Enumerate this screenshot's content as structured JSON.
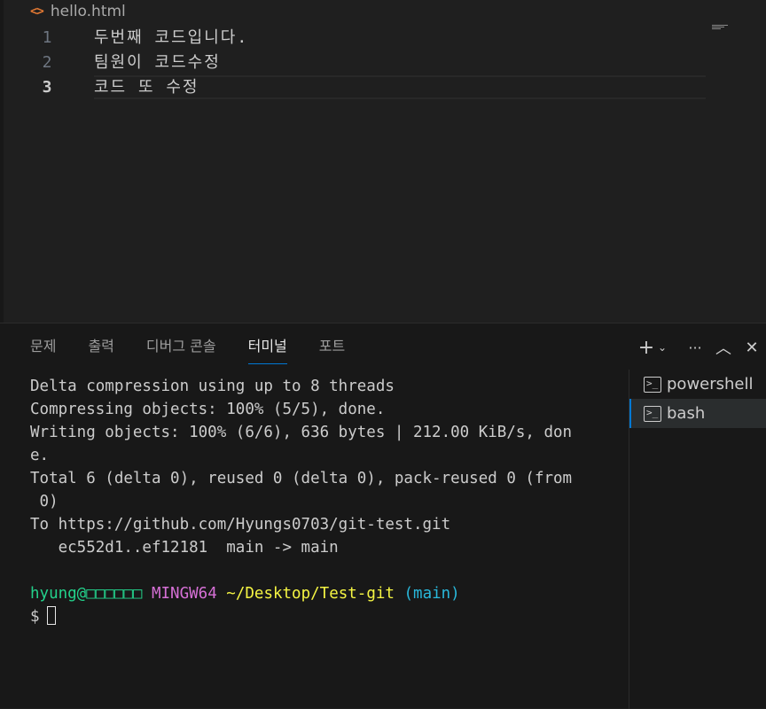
{
  "editor": {
    "file_name": "hello.html",
    "file_icon": "html-file-icon",
    "lines": [
      {
        "number": "1",
        "text": "두번째 코드입니다."
      },
      {
        "number": "2",
        "text": "팀원이 코드수정"
      },
      {
        "number": "3",
        "text": "코드 또 수정"
      }
    ]
  },
  "panel": {
    "tabs": [
      "문제",
      "출력",
      "디버그 콘솔",
      "터미널",
      "포트"
    ],
    "active_tab": "터미널",
    "actions": {
      "add": "+",
      "dropdown": "⌄",
      "more": "···",
      "maximize": "︿",
      "close": "✕"
    }
  },
  "terminal": {
    "lines": [
      "Delta compression using up to 8 threads",
      "Compressing objects: 100% (5/5), done.",
      "Writing objects: 100% (6/6), 636 bytes | 212.00 KiB/s, don",
      "e.",
      "Total 6 (delta 0), reused 0 (delta 0), pack-reused 0 (from",
      " 0)",
      "To https://github.com/Hyungs0703/git-test.git",
      "   ec552d1..ef12181  main -> main",
      ""
    ],
    "prompt": {
      "user_host": "hyung@□□□□□□",
      "system": "MINGW64",
      "path": "~/Desktop/Test-git",
      "branch": "(main)",
      "symbol": "$"
    },
    "instances": [
      {
        "name": "powershell",
        "selected": false
      },
      {
        "name": "bash",
        "selected": true
      }
    ]
  },
  "colors": {
    "accent": "#0078d4",
    "prompt_user": "#23d18b",
    "prompt_system": "#d670d6",
    "prompt_path": "#f5f543",
    "prompt_branch": "#29b8db"
  }
}
